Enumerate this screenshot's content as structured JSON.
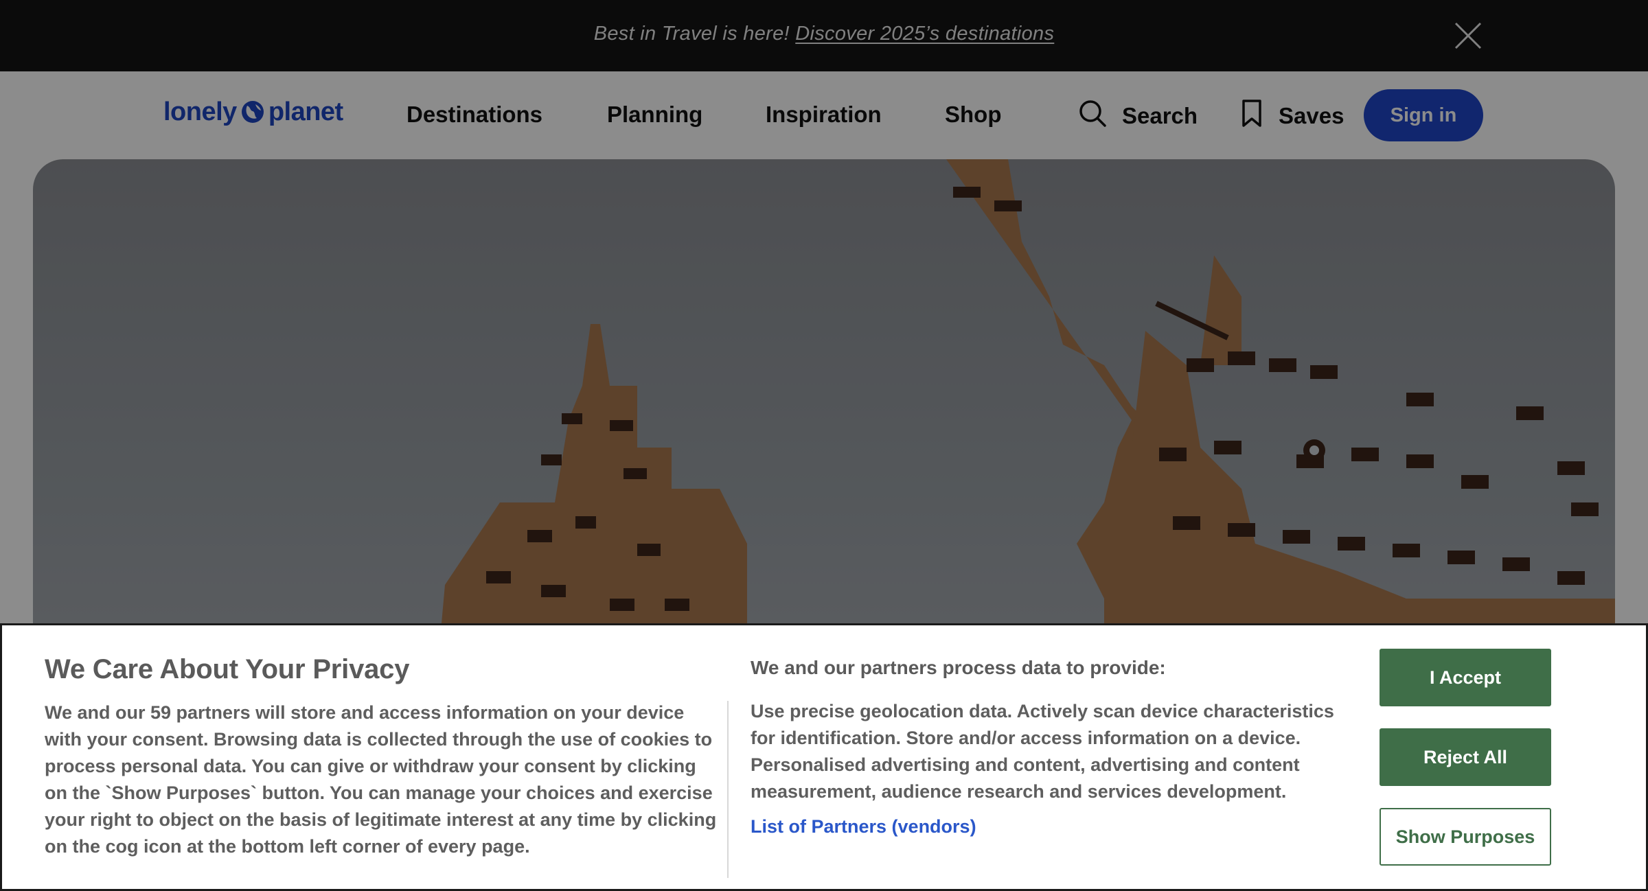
{
  "promo": {
    "text": "Best in Travel is here!",
    "link": "Discover 2025’s destinations",
    "close_icon": "close-icon"
  },
  "header": {
    "logo_text_left": "lonely",
    "logo_text_right": "planet",
    "nav": [
      "Destinations",
      "Planning",
      "Inspiration",
      "Shop"
    ],
    "search_label": "Search",
    "saves_label": "Saves",
    "signin_label": "Sign in",
    "brand_color": "#1f46c8"
  },
  "consent": {
    "title": "We Care About Your Privacy",
    "body": "We and our 59 partners will store and access information on your device with your consent. Browsing data is collected through the use of cookies to process personal data. You can give or withdraw your consent by clicking on the `Show Purposes` button. You can manage your choices and exercise your right to object on the basis of legitimate interest at any time by clicking on the cog icon at the bottom left corner of every page.",
    "purposes_heading": "We and our partners process data to provide:",
    "purposes_body": "Use precise geolocation data. Actively scan device characteristics for identification. Store and/or access information on a device. Personalised advertising and content, advertising and content measurement, audience research and services development.",
    "partners_link": "List of Partners (vendors)",
    "accept_label": "I Accept",
    "reject_label": "Reject All",
    "show_purposes_label": "Show Purposes",
    "button_color": "#3f6e48"
  }
}
